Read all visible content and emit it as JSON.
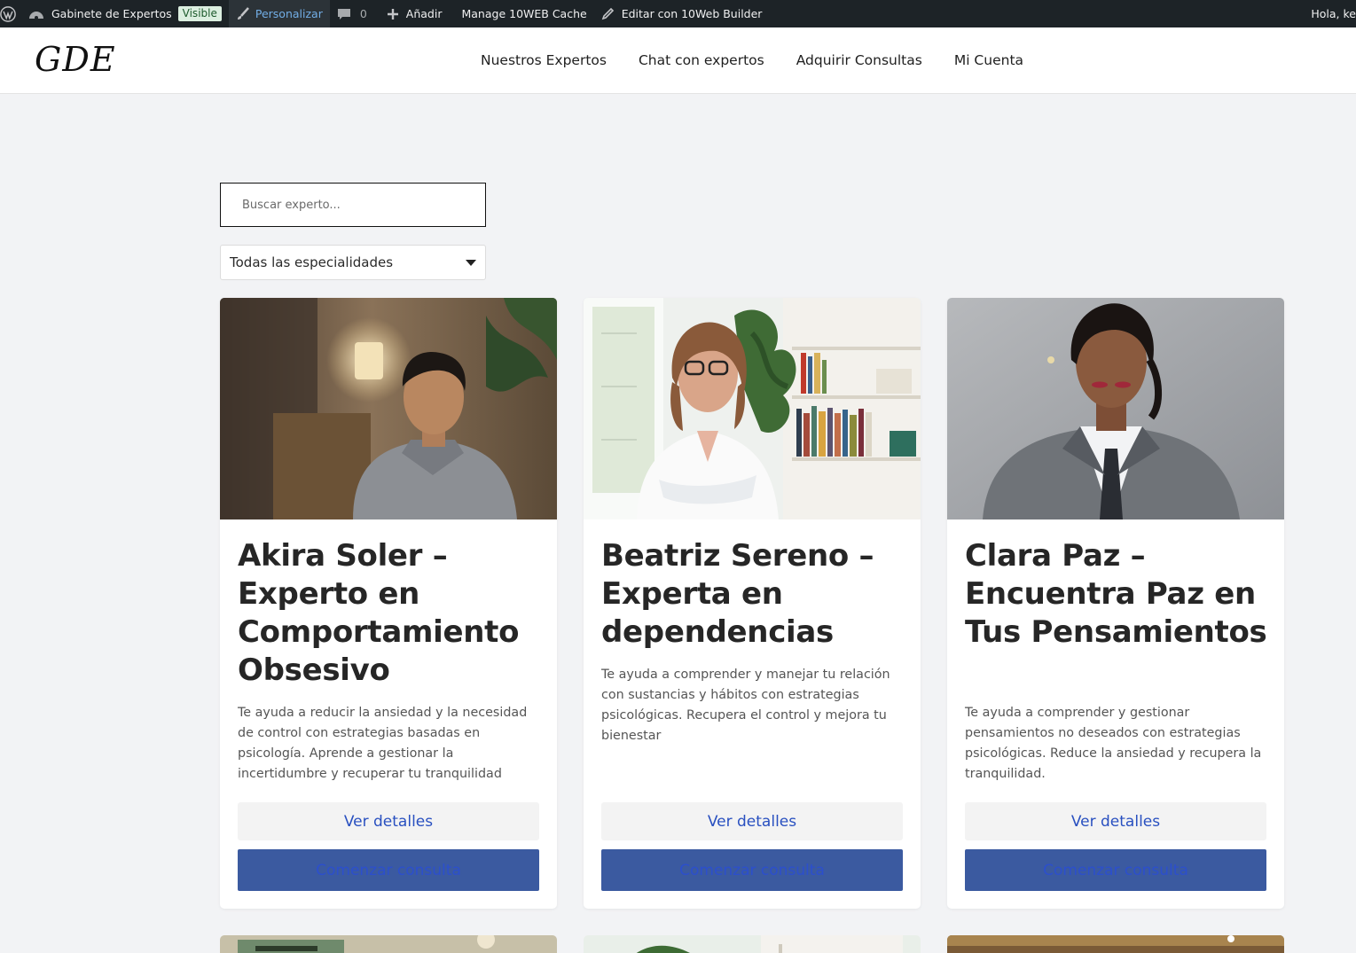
{
  "admin_bar": {
    "site_name": "Gabinete de Expertos",
    "visibility_badge": "Visible",
    "customize": "Personalizar",
    "comments_count": "0",
    "add_new": "Añadir",
    "cache": "Manage 10WEB Cache",
    "builder": "Editar con 10Web Builder",
    "greeting": "Hola, ke",
    "icons": [
      "wordpress-logo-icon",
      "dashboard-icon",
      "brush-icon",
      "comment-icon",
      "plus-icon",
      "pencil-icon"
    ]
  },
  "header": {
    "logo": "GDE",
    "nav": [
      "Nuestros Expertos",
      "Chat con expertos",
      "Adquirir Consultas",
      "Mi Cuenta"
    ]
  },
  "filters": {
    "search_placeholder": "Buscar experto...",
    "specialty_selected": "Todas las especialidades"
  },
  "colors": {
    "admin_bar_bg": "#1d2327",
    "page_bg": "#f2f3f5",
    "link_blue": "#2950c0",
    "consult_button_bg": "#3b5aa0"
  },
  "experts": [
    {
      "title": "Akira Soler – Experto en Comportamiento Obsesivo",
      "description": "Te ayuda a reducir la ansiedad y la necesidad de control con estrategias basadas en psicología. Aprende a gestionar la incertidumbre y recuperar tu tranquilidad",
      "details_label": "Ver detalles",
      "consult_label": "Comenzar consulta"
    },
    {
      "title": "Beatriz Sereno – Experta en dependencias",
      "description": "Te ayuda a comprender y manejar tu relación con sustancias y hábitos con estrategias psicológicas. Recupera el control y mejora tu bienestar",
      "details_label": "Ver detalles",
      "consult_label": "Comenzar consulta"
    },
    {
      "title": "Clara Paz – Encuentra Paz en Tus Pensamientos",
      "description": "Te ayuda a comprender y gestionar pensamientos no deseados con estrategias psicológicas. Reduce la ansiedad y recupera la tranquilidad.",
      "details_label": "Ver detalles",
      "consult_label": "Comenzar consulta"
    }
  ]
}
